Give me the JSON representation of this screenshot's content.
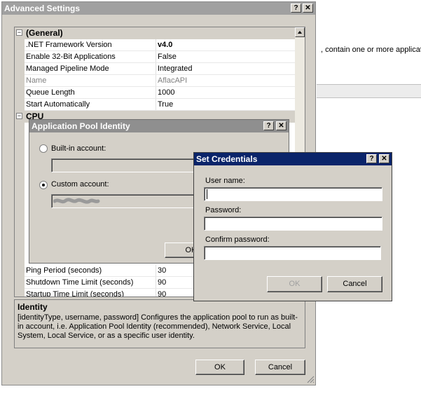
{
  "background": {
    "right_text": ", contain one or more applicati"
  },
  "advanced": {
    "title": "Advanced Settings",
    "help": "?",
    "close": "✕",
    "categories": {
      "general": "(General)",
      "cpu": "CPU"
    },
    "expander_minus": "⊟",
    "general_rows": [
      {
        "name": ".NET Framework Version",
        "value": "v4.0"
      },
      {
        "name": "Enable 32-Bit Applications",
        "value": "False"
      },
      {
        "name": "Managed Pipeline Mode",
        "value": "Integrated"
      },
      {
        "name": "Name",
        "value": "AflacAPI"
      },
      {
        "name": "Queue Length",
        "value": "1000"
      },
      {
        "name": "Start Automatically",
        "value": "True"
      }
    ],
    "process_rows": [
      {
        "name": "Ping Period (seconds)",
        "value": "30"
      },
      {
        "name": "Shutdown Time Limit (seconds)",
        "value": "90"
      },
      {
        "name": "Startup Time Limit (seconds)",
        "value": "90"
      }
    ],
    "desc_title": "Identity",
    "desc_text": "[identityType, username, password] Configures the application pool to run as built-in account, i.e. Application Pool Identity (recommended), Network Service, Local System, Local Service, or as a specific user identity.",
    "ok": "OK",
    "cancel": "Cancel"
  },
  "identity": {
    "title": "Application Pool Identity",
    "help": "?",
    "close": "✕",
    "builtin_label": "Built-in account:",
    "custom_label": "Custom account:",
    "ok": "OK"
  },
  "credentials": {
    "title": "Set Credentials",
    "help": "?",
    "close": "✕",
    "username_label": "User name:",
    "password_label": "Password:",
    "confirm_label": "Confirm password:",
    "username_value": "",
    "password_value": "",
    "confirm_value": "",
    "ok": "OK",
    "cancel": "Cancel"
  }
}
